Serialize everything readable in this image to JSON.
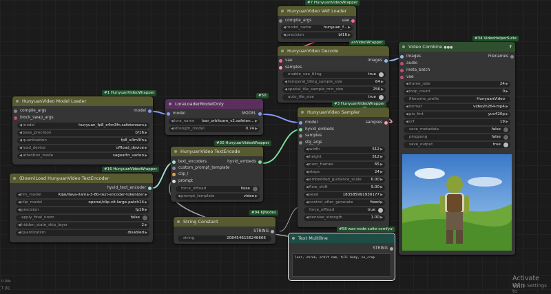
{
  "colors": {
    "accent_pink": "#c050a0",
    "link_blue": "#8899ff",
    "link_green": "#77dd99",
    "highlight_border": "#e6e6e6"
  },
  "vae_loader": {
    "badge": "#7 HunyuanVideoWrapper",
    "title": "HunyuanVideo VAE Loader",
    "input": "compile_args",
    "output": "vae",
    "model_name_label": "model_name",
    "model_name": "hunyuan_f...",
    "precision_label": "precision",
    "precision": "bf16"
  },
  "vae_decode": {
    "badge": "anVideoWrapper",
    "title": "HunyuanVideo Decode",
    "in_vae": "vae",
    "in_samples": "samples",
    "out_images": "images",
    "enable_vae_tiling_label": "enable_vae_tiling",
    "enable_vae_tiling": "true",
    "temporal_tiling_label": "temporal_tiling_sample_size",
    "temporal_tiling": "64",
    "spatial_tile_label": "spatial_tile_sample_min_size",
    "spatial_tile": "256",
    "auto_tile_label": "auto_tile_size",
    "auto_tile": "true"
  },
  "model_loader": {
    "badge": "#1 HunyuanVideoWrapper",
    "title": "HunyuanVideo Model Loader",
    "in_compile": "compile_args",
    "in_swap": "block_swap_args",
    "out": "model",
    "rows": [
      {
        "label": "model",
        "value": "hunyuan_fp8_e4m3fn.safetensors"
      },
      {
        "label": "base_precision",
        "value": "bf16"
      },
      {
        "label": "quantization",
        "value": "fp8_e4m3fn"
      },
      {
        "label": "load_device",
        "value": "offload_device"
      },
      {
        "label": "attention_mode",
        "value": "sageattn_varlen"
      }
    ]
  },
  "lora": {
    "badge": "#50",
    "title": "LoraLoaderModelOnly",
    "in": "model",
    "out": "MODEL",
    "lora_label": "lora_name",
    "lora_value": "loar_orbitcam_v2.safeten...",
    "strength_label": "strength_model",
    "strength_value": "0.74"
  },
  "text_encode": {
    "badge": "#30 HunyuanVideoWrapper",
    "title": "HunyuanVideo TextEncode",
    "in1": "text_encoders",
    "in2": "custom_prompt_template",
    "in3": "clip_l",
    "in4": "prompt",
    "out": "hyvid_embeds",
    "force_label": "force_offload",
    "force_value": "false",
    "tmpl_label": "prompt_template",
    "tmpl_value": "video"
  },
  "dl_encoder": {
    "badge": "#16 HunyuanVideoWrapper",
    "title": "(Down)Load HunyuanVideo TextEncoder",
    "out": "hyvid_text_encoder",
    "rows": [
      {
        "label": "llm_model",
        "value": "Kijai/llava-llama-3-8b-text-encoder-tokenizer"
      },
      {
        "label": "clip_model",
        "value": "openai/clip-vit-large-patch14"
      },
      {
        "label": "precision",
        "value": "fp16"
      },
      {
        "label": "apply_final_norm",
        "value": "false"
      },
      {
        "label": "hidden_state_skip_layer",
        "value": "2"
      },
      {
        "label": "quantization",
        "value": "disabled"
      }
    ]
  },
  "string_const": {
    "badge": "#94 KJNodes",
    "title": "String Constant",
    "out": "STRING",
    "label": "string",
    "value": "2084546156246666"
  },
  "sampler": {
    "badge": "#3 HunyuanVideoWrapper",
    "title": "HunyuanVideo Sampler",
    "in1": "model",
    "in2": "hyvid_embeds",
    "in3": "samples",
    "in4": "stg_args",
    "out": "samples",
    "rows": [
      {
        "label": "width",
        "value": "512"
      },
      {
        "label": "height",
        "value": "512"
      },
      {
        "label": "num_frames",
        "value": "65"
      },
      {
        "label": "steps",
        "value": "24"
      },
      {
        "label": "embedded_guidance_scale",
        "value": "6.00"
      },
      {
        "label": "flow_shift",
        "value": "9.00"
      },
      {
        "label": "seed",
        "value": "183585991930177"
      },
      {
        "label": "control_after_generate",
        "value": "fixed"
      },
      {
        "label": "force_offload",
        "value": "true"
      },
      {
        "label": "denoise_strength",
        "value": "1.00"
      }
    ]
  },
  "text_multiline": {
    "badge": "#58 was-node-suite-comfyui",
    "title": "Text Multiline",
    "out": "STRING",
    "text": "loar, shrek, orbit cam, full body, no_crop"
  },
  "video_combine": {
    "badge": "#34 VideoHelperSuite",
    "title": "Video Combine",
    "dots": "●●●",
    "help": "?",
    "in": [
      "images",
      "audio",
      "meta_batch",
      "vae"
    ],
    "out": "Filenames",
    "rows": [
      {
        "label": "frame_rate",
        "value": "24"
      },
      {
        "label": "loop_count",
        "value": "0"
      },
      {
        "label": "filename_prefix",
        "value": "HunyuanVideo"
      },
      {
        "label": "format",
        "value": "video/h264-mp4"
      },
      {
        "label": "pix_fmt",
        "value": "yuv420p"
      },
      {
        "label": "crf",
        "value": "19"
      },
      {
        "label": "save_metadata",
        "value": "false"
      },
      {
        "label": "pingpong",
        "value": "false"
      },
      {
        "label": "save_output",
        "value": "true"
      }
    ]
  },
  "watermark": {
    "line1": "Activate Win",
    "line2": "Go to Settings to"
  },
  "corner": {
    "a": "0.00s",
    "b": "T [0]"
  }
}
